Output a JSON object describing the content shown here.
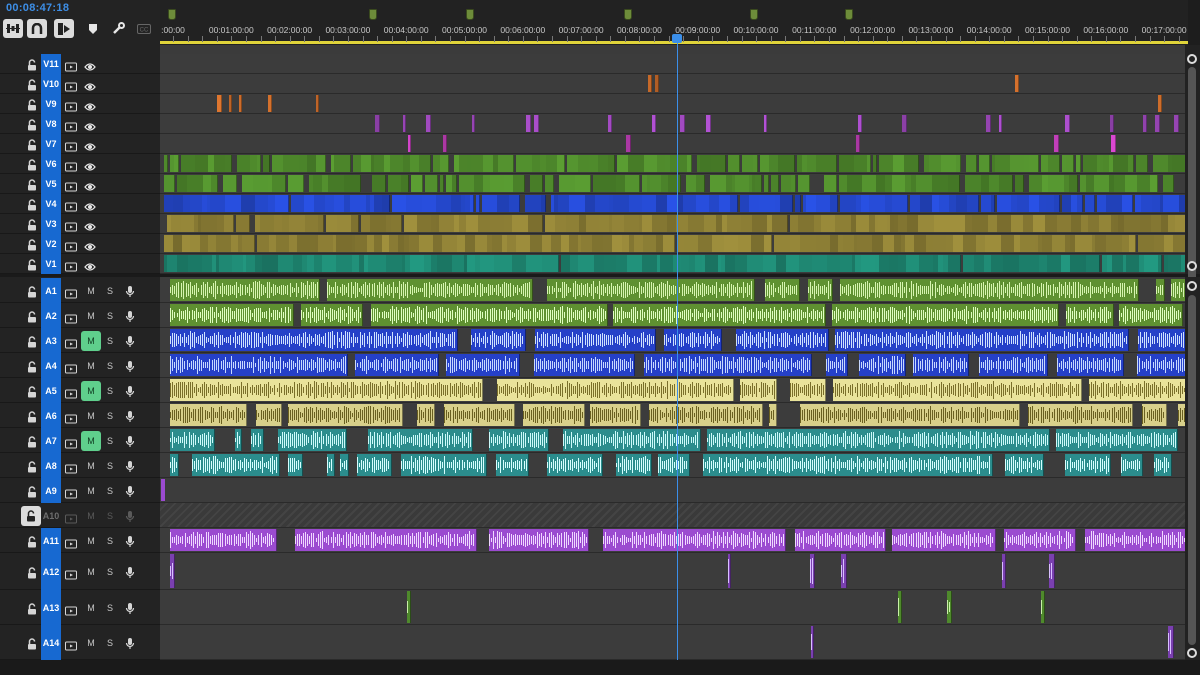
{
  "timecode": "00:08:47:18",
  "toolbar": {
    "tools": [
      "nest-sequence-icon",
      "snap-icon",
      "linked-selection-icon",
      "add-marker-icon",
      "wrench-icon",
      "captions-icon"
    ]
  },
  "ruler": {
    "labels": [
      ":00:00",
      "00:01:00:00",
      "00:02:00:00",
      "00:03:00:00",
      "00:04:00:00",
      "00:05:00:00",
      "00:06:00:00",
      "00:07:00:00",
      "00:08:00:00",
      "00:09:00:00",
      "00:10:00:00",
      "00:11:00:00",
      "00:12:00:00",
      "00:13:00:00",
      "00:14:00:00",
      "00:15:00:00",
      "00:16:00:00",
      "00:17:00:00"
    ]
  },
  "video_tracks": [
    {
      "name": "V11",
      "color": "#c35fae"
    },
    {
      "name": "V10",
      "color": "#c86a2a"
    },
    {
      "name": "V9",
      "color": "#c86a2a"
    },
    {
      "name": "V8",
      "color": "#a14ac0"
    },
    {
      "name": "V7",
      "color": "#c03fb8"
    },
    {
      "name": "V6",
      "color": "#4f8a2c"
    },
    {
      "name": "V5",
      "color": "#4f8a2c"
    },
    {
      "name": "V4",
      "color": "#2447c9"
    },
    {
      "name": "V3",
      "color": "#8c7e35"
    },
    {
      "name": "V2",
      "color": "#8c7e35"
    },
    {
      "name": "V1",
      "color": "#1e8570"
    }
  ],
  "audio_tracks": [
    {
      "name": "A1",
      "m": "M",
      "s": "S",
      "mute_on": false,
      "color": "#5f9131",
      "hl": "#d7f5b0"
    },
    {
      "name": "A2",
      "m": "M",
      "s": "S",
      "mute_on": false,
      "color": "#5f9131",
      "hl": "#e0ffc0"
    },
    {
      "name": "A3",
      "m": "M",
      "s": "S",
      "mute_on": true,
      "color": "#2540c8",
      "hl": "#cfe0ff"
    },
    {
      "name": "A4",
      "m": "M",
      "s": "S",
      "mute_on": false,
      "color": "#2540c8",
      "hl": "#c7d8ff"
    },
    {
      "name": "A5",
      "m": "M",
      "s": "S",
      "mute_on": true,
      "color": "#e9e39a",
      "hl": "#7a6f2a"
    },
    {
      "name": "A6",
      "m": "M",
      "s": "S",
      "mute_on": false,
      "color": "#d8d08a",
      "hl": "#6a6020"
    },
    {
      "name": "A7",
      "m": "M",
      "s": "S",
      "mute_on": true,
      "color": "#2b8d8d",
      "hl": "#ccfafa"
    },
    {
      "name": "A8",
      "m": "M",
      "s": "S",
      "mute_on": false,
      "color": "#2b8d8d",
      "hl": "#d6ffff"
    },
    {
      "name": "A9",
      "m": "M",
      "s": "S",
      "mute_on": false,
      "color": "#9b4bd0",
      "hl": "#f0d8ff"
    },
    {
      "name": "A10",
      "m": "M",
      "s": "S",
      "mute_on": false,
      "locked": true,
      "color": "#555555",
      "hl": "#777777"
    },
    {
      "name": "A11",
      "m": "M",
      "s": "S",
      "mute_on": false,
      "color": "#9b4bd0",
      "hl": "#f0d8ff"
    },
    {
      "name": "A12",
      "m": "M",
      "s": "S",
      "mute_on": false,
      "color": "#7a40b0",
      "hl": "#d9bfff"
    },
    {
      "name": "A13",
      "m": "M",
      "s": "S",
      "mute_on": false,
      "color": "#4f8a2c",
      "hl": "#c9f0a8"
    },
    {
      "name": "A14",
      "m": "M",
      "s": "S",
      "mute_on": false,
      "color": "#7a40b0",
      "hl": "#d9bfff"
    }
  ]
}
